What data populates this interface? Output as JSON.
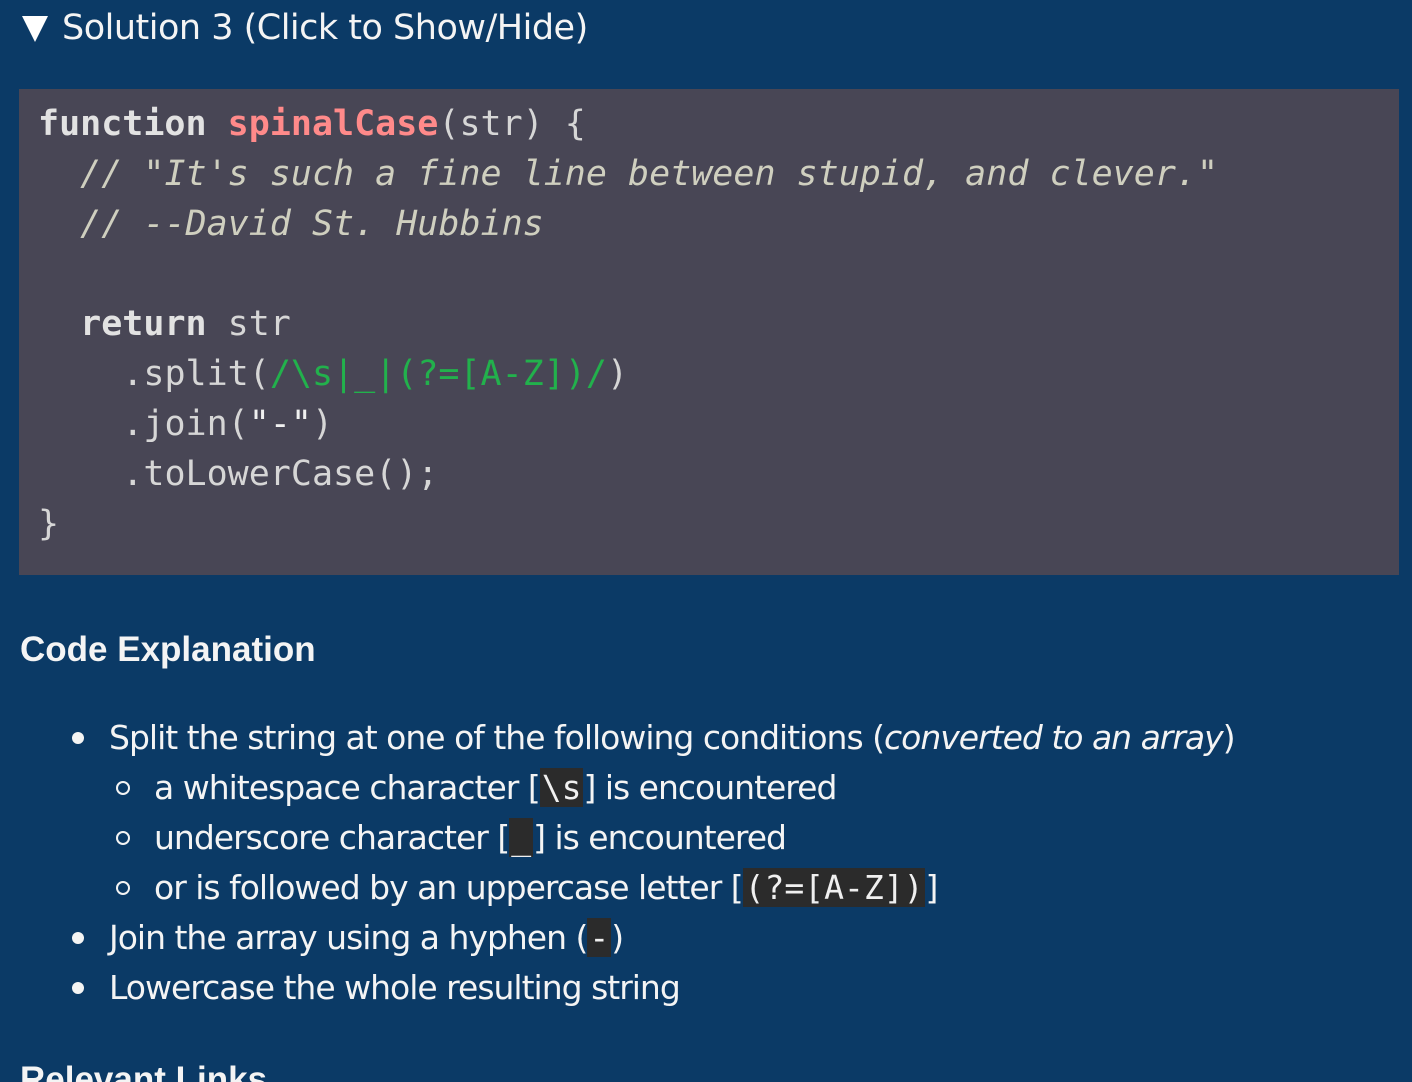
{
  "summary": {
    "label": "Solution 3 (Click to Show/Hide)"
  },
  "code": {
    "l1": {
      "kw": "function",
      "fn": "spinalCase",
      "rest": "(str) {"
    },
    "l2": {
      "indent": "  ",
      "comment": "// \"It's such a fine line between stupid, and clever.\""
    },
    "l3": {
      "indent": "  ",
      "comment": "// --David St. Hubbins"
    },
    "l4": {
      "text": ""
    },
    "l5": {
      "indent": "  ",
      "kw": "return",
      "rest": " str"
    },
    "l6": {
      "indent": "    ",
      "pre": ".split(",
      "regex": "/\\s|_|(?=[A-Z])/",
      "post": ")"
    },
    "l7": {
      "indent": "    ",
      "pre": ".join(",
      "str": "\"-\"",
      "post": ")"
    },
    "l8": {
      "indent": "    ",
      "text": ".toLowerCase();"
    },
    "l9": {
      "text": "}"
    }
  },
  "explanation": {
    "heading": "Code Explanation",
    "item1": {
      "pre": "Split the string at one of the following conditions (",
      "em": "converted to an array",
      "post": ")"
    },
    "sub1": {
      "pre": "a whitespace character [",
      "code": "\\s",
      "post": "] is encountered"
    },
    "sub2": {
      "pre": "underscore character [",
      "code": "_",
      "post": "] is encountered"
    },
    "sub3": {
      "pre": "or is followed by an uppercase letter [",
      "code": "(?=[A-Z])",
      "post": "]"
    },
    "item2": {
      "pre": "Join the array using a hyphen (",
      "code": "-",
      "post": ")"
    },
    "item3": {
      "text": "Lowercase the whole resulting string"
    }
  },
  "next_heading": "Relevant Links"
}
